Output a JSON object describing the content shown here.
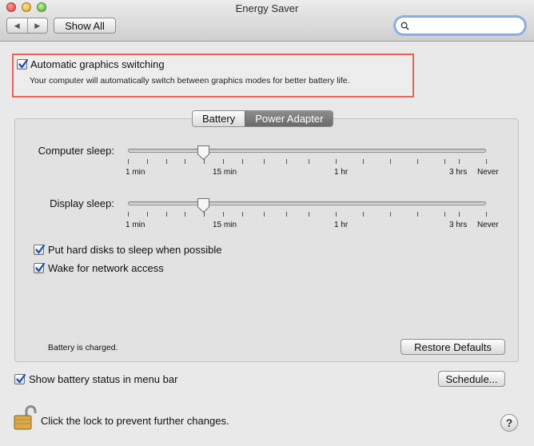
{
  "window": {
    "title": "Energy Saver"
  },
  "toolbar": {
    "back": "◀",
    "forward": "▶",
    "show_all": "Show All"
  },
  "search": {
    "value": "",
    "placeholder": ""
  },
  "graphics": {
    "label": "Automatic graphics switching",
    "checked": true,
    "description": "Your computer will automatically switch between graphics modes for better battery life."
  },
  "tabs": [
    {
      "label": "Battery",
      "active": false
    },
    {
      "label": "Power Adapter",
      "active": true
    }
  ],
  "sliders": {
    "computer_sleep": {
      "label": "Computer sleep:",
      "value": "15 min",
      "ticks": {
        "min": "1 min",
        "fifteen": "15 min",
        "hour": "1 hr",
        "three": "3 hrs",
        "never": "Never"
      }
    },
    "display_sleep": {
      "label": "Display sleep:",
      "value": "15 min",
      "ticks": {
        "min": "1 min",
        "fifteen": "15 min",
        "hour": "1 hr",
        "three": "3 hrs",
        "never": "Never"
      }
    }
  },
  "options": {
    "hard_disks": {
      "label": "Put hard disks to sleep when possible",
      "checked": true
    },
    "wake_network": {
      "label": "Wake for network access",
      "checked": true
    }
  },
  "status_text": "Battery is charged.",
  "buttons": {
    "restore": "Restore Defaults",
    "schedule": "Schedule...",
    "help": "?"
  },
  "menu_bar_option": {
    "label": "Show battery status in menu bar",
    "checked": true
  },
  "lock_text": "Click the lock to prevent further changes.",
  "colors": {
    "highlight_border": "#e8625a",
    "check": "#1f4fa8",
    "active_tab": "#6a6a6a"
  }
}
